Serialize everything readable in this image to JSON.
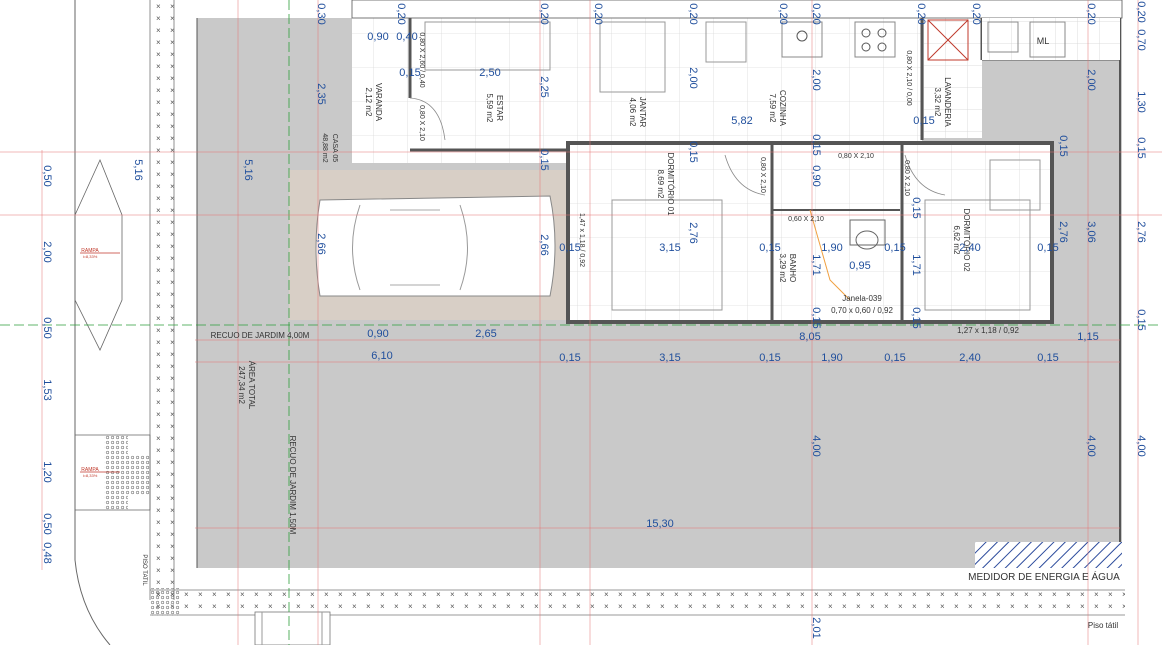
{
  "rooms": [
    {
      "name": "VARANDA",
      "area": "2,12 m2"
    },
    {
      "name": "ESTAR",
      "area": "5,59 m2"
    },
    {
      "name": "JANTAR",
      "area": "4,06 m2"
    },
    {
      "name": "COZINHA",
      "area": "7,59 m2"
    },
    {
      "name": "LAVANDERIA",
      "area": "3,32 m2"
    },
    {
      "name": "DORMITÓRIO 01",
      "area": "8,69 m2"
    },
    {
      "name": "BANHO",
      "area": "3,29 m2"
    },
    {
      "name": "DORMITÓRIO 02",
      "area": "6,62 m2"
    }
  ],
  "house_label": {
    "name": "CASA 05",
    "area": "48,88 m2"
  },
  "lot_label": {
    "name": "ÁREA TOTAL",
    "area": "247,34 m2"
  },
  "setback_front": "RECUO DE JARDIM 4,00M",
  "setback_side": "RECUO DE JARDIM 1,50M",
  "meter_label": "MEDIDOR DE ENERGIA E ÁGUA",
  "tactile_floor": "Piso tátil",
  "tactile_floor_side": "PISO TATIL",
  "ramp_labels": [
    "RAMPA",
    "RAMPA"
  ],
  "ramp_notes": [
    "i=8,33%",
    "i=8,33%"
  ],
  "laundry_fixture": "ML",
  "window_tags": {
    "window_name": "Janela-039",
    "window_size": "0,70 x 0,60 / 0,92",
    "dorm2_window": "1,27 x 1,18 / 0,92",
    "dorm1_window": "1,47 x 1,18 / 0,92"
  },
  "door_tags": {
    "veranda": "0,80 X 2,10",
    "door_dorm1": "0,80 X 2,10",
    "door_hall": "0,80 X 2,10",
    "door_dorm2": "0,80 X 2,10",
    "door_bath": "0,60 X 2,10",
    "laundry_door": "0,80 X 2,10 / 0,00",
    "estar_window": "0,80 X 2,60 / 0,40"
  },
  "dims": {
    "total_width": "15,30",
    "setback_width": "6,10",
    "veranda_depth": "2,50",
    "kitchen_span": "5,82",
    "r1_015": "0,15",
    "r1_315": "3,15",
    "r1_015b": "0,15",
    "r1_190": "1,90",
    "r1_015c": "0,15",
    "r1_240": "2,40",
    "r1_015d": "0,15",
    "sub_090": "0,90",
    "sub_265": "2,65",
    "sub_805": "8,05",
    "sub_115": "1,15",
    "left_516": "5,16",
    "left2_516": "5,16",
    "left_235": "2,35",
    "left_266": "2,66",
    "car_266": "2,66",
    "height_225": "2,25",
    "height_200": "2,00",
    "height_200b": "2,00",
    "d1_276": "2,76",
    "d1_315": "3,15",
    "d1_015": "0,15",
    "d1_015b": "0,15",
    "hall_190": "1,90",
    "hall_095": "0,95",
    "hall_171": "1,71",
    "hall_171b": "1,71",
    "hall_090": "0,90",
    "hall_015": "0,15",
    "hall_015b": "0,15",
    "hall_015c": "0,15",
    "d2_276": "2,76",
    "d2_240": "2,40",
    "d2_015": "0,15",
    "d2_015b": "0,15",
    "right_306": "3,06",
    "right_200": "2,00",
    "right_400": "4,00",
    "mid_400": "4,00",
    "mid_201": "2,01",
    "mid_015": "0,15",
    "mid_015b": "0,15",
    "top_030": "0,30",
    "top_020a": "0,20",
    "top_020b": "0,20",
    "top_020c": "0,20",
    "top_020d": "0,20",
    "top_020e": "0,20",
    "top_020f": "0,20",
    "top_020g": "0,20",
    "top_020h": "0,20",
    "top_020i": "0,20",
    "top_090": "0,90",
    "top_040": "0,40",
    "top_015": "0,15",
    "top_015b": "0,15",
    "top_015c": "0,15",
    "top_015d": "0,15",
    "far_020": "0,20",
    "far_070": "0,70",
    "far_130": "1,30",
    "far_015": "0,15",
    "far_276": "2,76",
    "far_015b": "0,15",
    "far_400": "4,00",
    "farleft_050": "0,50",
    "farleft_200": "2,00",
    "farleft_050b": "0,50",
    "farleft_153": "1,53",
    "farleft_120": "1,20",
    "farleft_050c": "0,50",
    "farleft_048": "0,48"
  },
  "colors": {
    "dimension_text": "#1f4e9c",
    "dimension_line": "#e57373",
    "axis_line": "#2e9e3b",
    "lot_fill": "#c9c9c9",
    "garage_fill": "#d8cfc6",
    "wall": "#555555",
    "tile_line": "#dadada"
  }
}
